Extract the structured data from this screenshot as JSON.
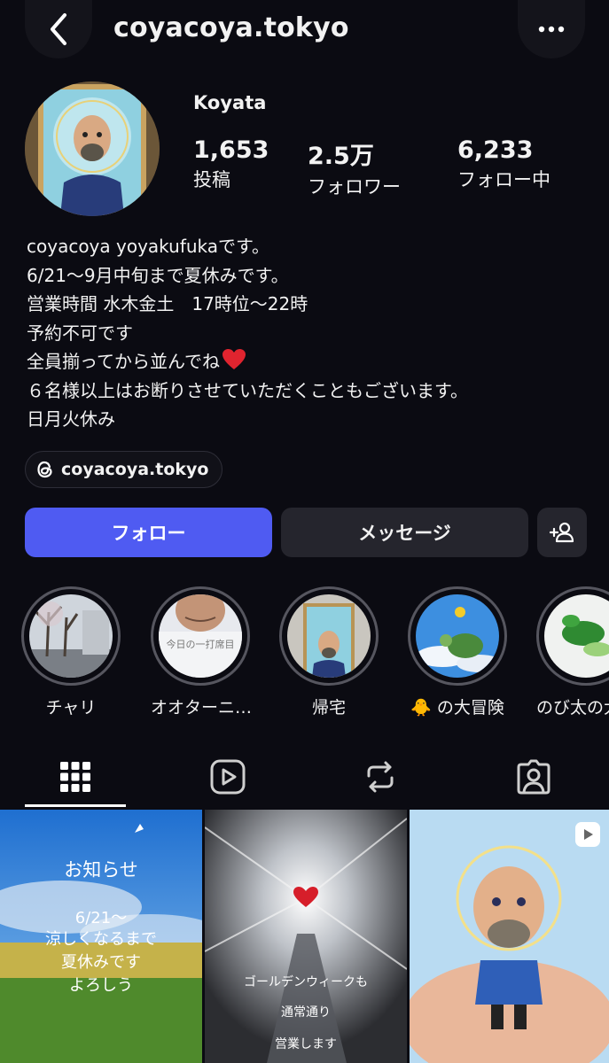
{
  "header": {
    "username": "coyacoya.tokyo"
  },
  "profile": {
    "name": "Koyata",
    "stats": [
      {
        "value": "1,653",
        "label": "投稿"
      },
      {
        "value": "2.5万",
        "label": "フォロワー"
      },
      {
        "value": "6,233",
        "label": "フォロー中"
      }
    ],
    "bio": [
      "coyacoya yoyakufukaです。",
      "6/21～9月中旬まで夏休みです。",
      "営業時間 水木金土　17時位～22時",
      "予約不可です",
      "全員揃ってから並んでね",
      "６名様以上はお断りさせていただくこともございます。",
      "日月火休み"
    ],
    "threads_link": "coyacoya.tokyo"
  },
  "actions": {
    "follow": "フォロー",
    "message": "メッセージ"
  },
  "highlights": [
    {
      "label": "チャリ"
    },
    {
      "label": "オオターニ…",
      "overlay_text": "今日の一打席目"
    },
    {
      "label": "帰宅"
    },
    {
      "label": "の大冒険",
      "emoji": "🐥"
    },
    {
      "label": "のび太の大"
    }
  ],
  "posts": [
    {
      "lines": [
        "お知らせ",
        "6/21～",
        "涼しくなるまで",
        "夏休みです",
        "よろしう"
      ]
    },
    {
      "lines": [
        "ゴールデンウィークも",
        "通常通り",
        "営業します"
      ]
    },
    {
      "type": "reel"
    }
  ],
  "colors": {
    "accent": "#4f5bf2",
    "background": "#0b0b12",
    "button_dark": "#25252d",
    "heart": "#e0242f"
  }
}
